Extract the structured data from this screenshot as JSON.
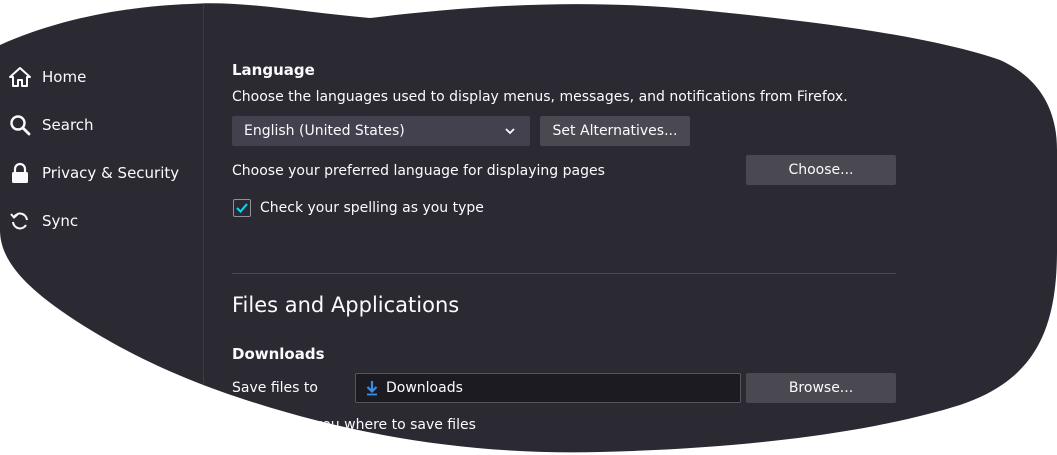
{
  "sidebar": {
    "items": [
      {
        "label": "Home",
        "icon": "home-icon"
      },
      {
        "label": "Search",
        "icon": "search-icon"
      },
      {
        "label": "Privacy & Security",
        "icon": "lock-icon"
      },
      {
        "label": "Sync",
        "icon": "sync-icon"
      }
    ]
  },
  "language": {
    "heading": "Language",
    "description": "Choose the languages used to display menus, messages, and notifications from Firefox.",
    "selected_language": "English (United States)",
    "set_alternatives_label": "Set Alternatives...",
    "pages_description": "Choose your preferred language for displaying pages",
    "choose_label": "Choose...",
    "spellcheck_label": "Check your spelling as you type",
    "spellcheck_checked": true
  },
  "files": {
    "title": "Files and Applications",
    "downloads_heading": "Downloads",
    "save_files_to_label": "Save files to",
    "download_folder": "Downloads",
    "browse_label": "Browse...",
    "ask_label": "Always ask you where to save files"
  },
  "colors": {
    "background": "#2b2a33",
    "button": "#4a4952",
    "accent": "#0df",
    "download_arrow": "#3a8ee6"
  }
}
